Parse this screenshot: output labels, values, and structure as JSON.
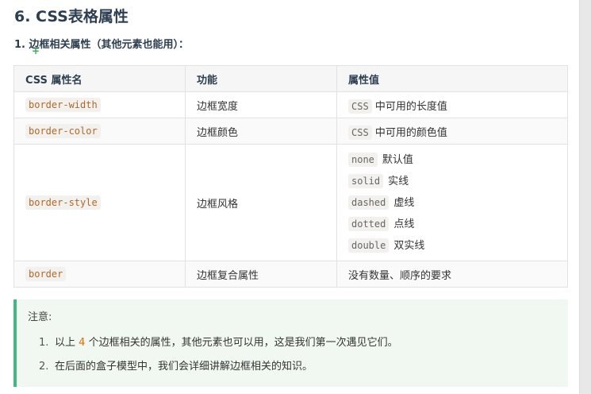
{
  "heading": "6. CSS表格属性",
  "subheading": "1. 边框相关属性（其他元素也能用）：",
  "table": {
    "headers": [
      "CSS 属性名",
      "功能",
      "属性值"
    ],
    "rows": [
      {
        "name": "border-width",
        "func": "边框宽度",
        "value_code": "CSS",
        "value_text": "中可用的长度值"
      },
      {
        "name": "border-color",
        "func": "边框颜色",
        "value_code": "CSS",
        "value_text": "中可用的颜色值"
      },
      {
        "name": "border-style",
        "func": "边框风格",
        "values": [
          {
            "code": "none",
            "desc": "默认值"
          },
          {
            "code": "solid",
            "desc": "实线"
          },
          {
            "code": "dashed",
            "desc": "虚线"
          },
          {
            "code": "dotted",
            "desc": "点线"
          },
          {
            "code": "double",
            "desc": "双实线"
          }
        ]
      },
      {
        "name": "border",
        "func": "边框复合属性",
        "value_text": "没有数量、顺序的要求"
      }
    ]
  },
  "note": {
    "title": "注意:",
    "items": [
      {
        "num": "1.",
        "pre": "以上",
        "highlight": "4",
        "post": "个边框相关的属性，其他元素也可以用，这是我们第一次遇见它们。"
      },
      {
        "num": "2.",
        "text": "在后面的盒子模型中，我们会详细讲解边框相关的知识。"
      }
    ]
  },
  "colors": {
    "code_text": "#b0682a",
    "note_border": "#42b983",
    "note_bg": "#f1f8f1",
    "highlight": "#e96900"
  }
}
